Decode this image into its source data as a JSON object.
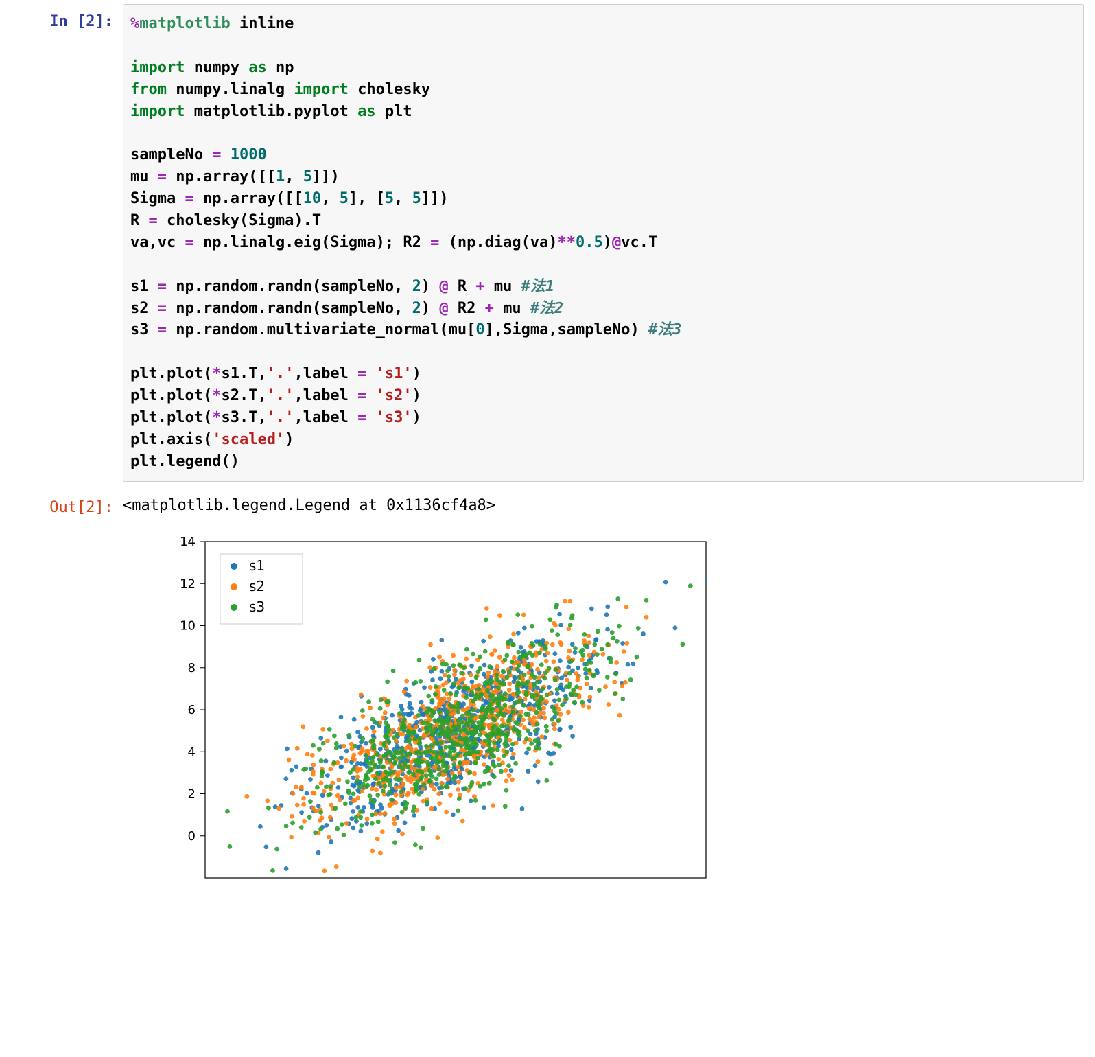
{
  "cell": {
    "in_prompt": "In [2]:",
    "out_prompt": "Out[2]:",
    "output_text": "<matplotlib.legend.Legend at 0x1136cf4a8>"
  },
  "code": {
    "tokens": [
      [
        [
          "tok-op",
          "%"
        ],
        [
          "tok-magic",
          "matplotlib"
        ],
        [
          "plain",
          " "
        ],
        [
          "plain",
          "inline"
        ]
      ],
      [],
      [
        [
          "tok-kw",
          "import"
        ],
        [
          "plain",
          " numpy "
        ],
        [
          "tok-kwas",
          "as"
        ],
        [
          "plain",
          " np"
        ]
      ],
      [
        [
          "tok-kw",
          "from"
        ],
        [
          "plain",
          " numpy.linalg "
        ],
        [
          "tok-kw",
          "import"
        ],
        [
          "plain",
          " cholesky"
        ]
      ],
      [
        [
          "tok-kw",
          "import"
        ],
        [
          "plain",
          " matplotlib.pyplot "
        ],
        [
          "tok-kwas",
          "as"
        ],
        [
          "plain",
          " plt"
        ]
      ],
      [],
      [
        [
          "plain",
          "sampleNo "
        ],
        [
          "tok-op",
          "="
        ],
        [
          "plain",
          " "
        ],
        [
          "tok-num",
          "1000"
        ]
      ],
      [
        [
          "plain",
          "mu "
        ],
        [
          "tok-op",
          "="
        ],
        [
          "plain",
          " np.array([["
        ],
        [
          "tok-num",
          "1"
        ],
        [
          "plain",
          ", "
        ],
        [
          "tok-num",
          "5"
        ],
        [
          "plain",
          "]])"
        ]
      ],
      [
        [
          "plain",
          "Sigma "
        ],
        [
          "tok-op",
          "="
        ],
        [
          "plain",
          " np.array([["
        ],
        [
          "tok-num",
          "10"
        ],
        [
          "plain",
          ", "
        ],
        [
          "tok-num",
          "5"
        ],
        [
          "plain",
          "], ["
        ],
        [
          "tok-num",
          "5"
        ],
        [
          "plain",
          ", "
        ],
        [
          "tok-num",
          "5"
        ],
        [
          "plain",
          "]])"
        ]
      ],
      [
        [
          "plain",
          "R "
        ],
        [
          "tok-op",
          "="
        ],
        [
          "plain",
          " cholesky(Sigma).T"
        ]
      ],
      [
        [
          "plain",
          "va,vc "
        ],
        [
          "tok-op",
          "="
        ],
        [
          "plain",
          " np.linalg.eig(Sigma); R2 "
        ],
        [
          "tok-op",
          "="
        ],
        [
          "plain",
          " (np.diag(va)"
        ],
        [
          "tok-op",
          "**"
        ],
        [
          "tok-num",
          "0.5"
        ],
        [
          "plain",
          ")"
        ],
        [
          "tok-dec",
          "@"
        ],
        [
          "plain",
          "vc.T"
        ]
      ],
      [],
      [
        [
          "plain",
          "s1 "
        ],
        [
          "tok-op",
          "="
        ],
        [
          "plain",
          " np.random.randn(sampleNo, "
        ],
        [
          "tok-num",
          "2"
        ],
        [
          "plain",
          ") "
        ],
        [
          "tok-dec",
          "@"
        ],
        [
          "plain",
          " R "
        ],
        [
          "tok-op",
          "+"
        ],
        [
          "plain",
          " mu "
        ],
        [
          "tok-comment",
          "#法1"
        ]
      ],
      [
        [
          "plain",
          "s2 "
        ],
        [
          "tok-op",
          "="
        ],
        [
          "plain",
          " np.random.randn(sampleNo, "
        ],
        [
          "tok-num",
          "2"
        ],
        [
          "plain",
          ") "
        ],
        [
          "tok-dec",
          "@"
        ],
        [
          "plain",
          " R2 "
        ],
        [
          "tok-op",
          "+"
        ],
        [
          "plain",
          " mu "
        ],
        [
          "tok-comment",
          "#法2"
        ]
      ],
      [
        [
          "plain",
          "s3 "
        ],
        [
          "tok-op",
          "="
        ],
        [
          "plain",
          " np.random.multivariate_normal(mu["
        ],
        [
          "tok-num",
          "0"
        ],
        [
          "plain",
          "],Sigma,sampleNo) "
        ],
        [
          "tok-comment",
          "#法3"
        ]
      ],
      [],
      [
        [
          "plain",
          "plt.plot("
        ],
        [
          "tok-op",
          "*"
        ],
        [
          "plain",
          "s1.T,"
        ],
        [
          "tok-str",
          "'.'"
        ],
        [
          "plain",
          ",label "
        ],
        [
          "tok-op",
          "="
        ],
        [
          "plain",
          " "
        ],
        [
          "tok-str",
          "'s1'"
        ],
        [
          "plain",
          ")"
        ]
      ],
      [
        [
          "plain",
          "plt.plot("
        ],
        [
          "tok-op",
          "*"
        ],
        [
          "plain",
          "s2.T,"
        ],
        [
          "tok-str",
          "'.'"
        ],
        [
          "plain",
          ",label "
        ],
        [
          "tok-op",
          "="
        ],
        [
          "plain",
          " "
        ],
        [
          "tok-str",
          "'s2'"
        ],
        [
          "plain",
          ")"
        ]
      ],
      [
        [
          "plain",
          "plt.plot("
        ],
        [
          "tok-op",
          "*"
        ],
        [
          "plain",
          "s3.T,"
        ],
        [
          "tok-str",
          "'.'"
        ],
        [
          "plain",
          ",label "
        ],
        [
          "tok-op",
          "="
        ],
        [
          "plain",
          " "
        ],
        [
          "tok-str",
          "'s3'"
        ],
        [
          "plain",
          ")"
        ]
      ],
      [
        [
          "plain",
          "plt.axis("
        ],
        [
          "tok-str",
          "'scaled'"
        ],
        [
          "plain",
          ")"
        ]
      ],
      [
        [
          "plain",
          "plt.legend()"
        ]
      ]
    ]
  },
  "chart_data": {
    "type": "scatter",
    "title": "",
    "xlim": [
      -10,
      12
    ],
    "ylim_visible": [
      -2,
      14
    ],
    "y_ticks": [
      0,
      2,
      4,
      6,
      8,
      10,
      12,
      14
    ],
    "axis": "scaled",
    "legend_position": "upper left",
    "distribution": {
      "mu": [
        1,
        5
      ],
      "Sigma": [
        [
          10,
          5
        ],
        [
          5,
          5
        ]
      ],
      "sample_count_per_series": 1000
    },
    "series": [
      {
        "name": "s1",
        "color": "#1f77b4",
        "method": "cholesky(Sigma).T"
      },
      {
        "name": "s2",
        "color": "#ff7f0e",
        "method": "eig-based sqrt"
      },
      {
        "name": "s3",
        "color": "#2ca02c",
        "method": "np.random.multivariate_normal"
      }
    ]
  }
}
